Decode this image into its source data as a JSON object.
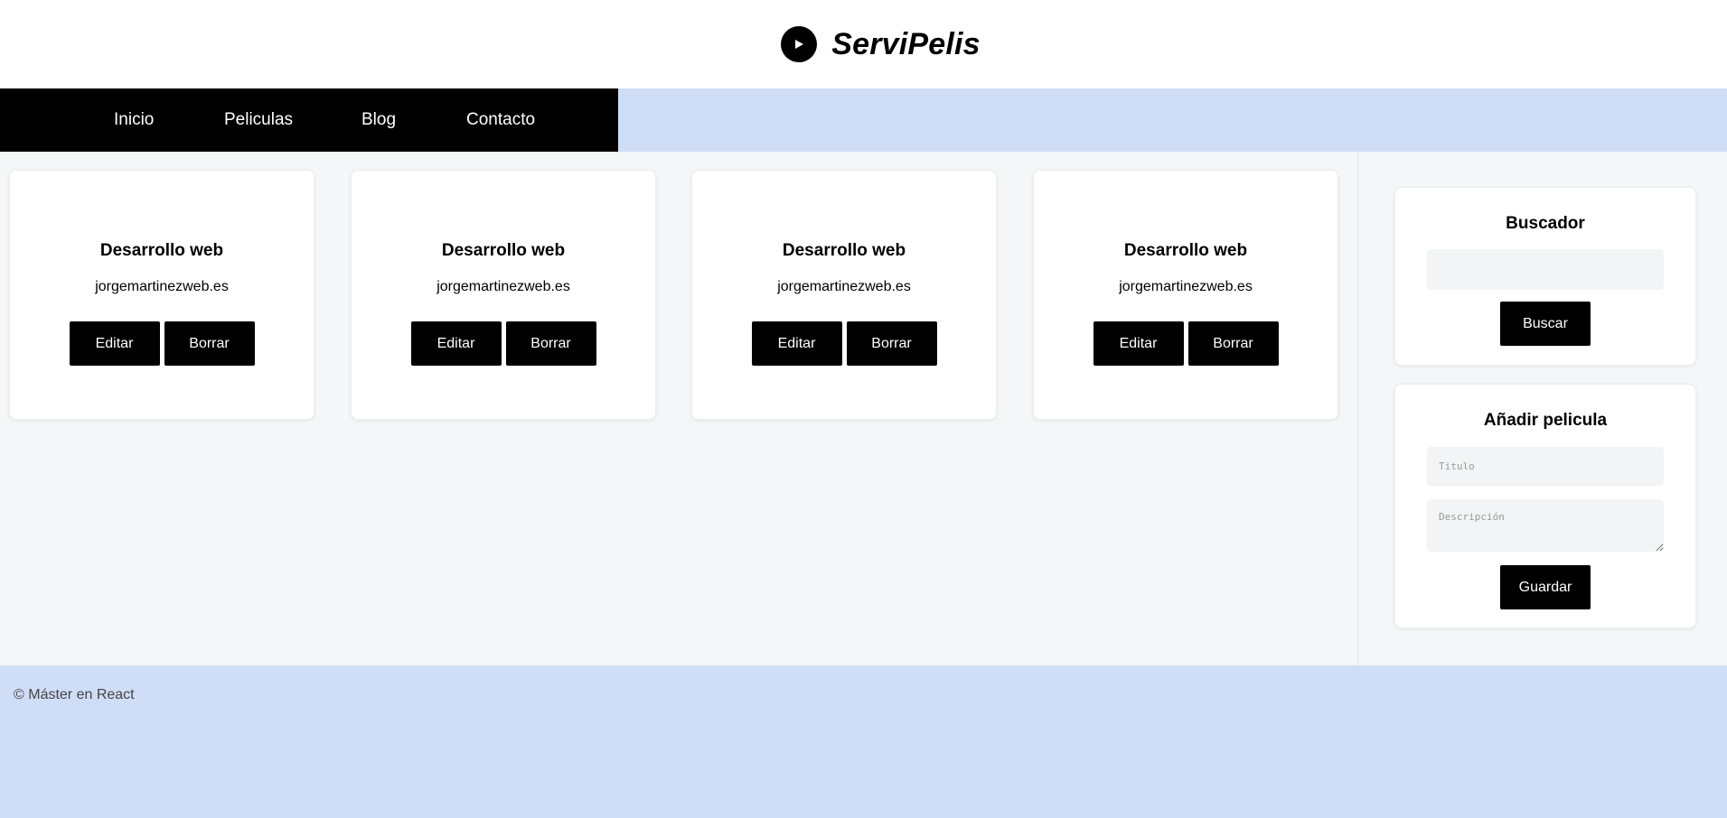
{
  "header": {
    "title": "ServiPelis",
    "logo_icon": "play-icon"
  },
  "nav": {
    "items": [
      {
        "label": "Inicio"
      },
      {
        "label": "Peliculas"
      },
      {
        "label": "Blog"
      },
      {
        "label": "Contacto"
      }
    ]
  },
  "cards": [
    {
      "title": "Desarrollo web",
      "text": "jorgemartinezweb.es",
      "edit_label": "Editar",
      "delete_label": "Borrar"
    },
    {
      "title": "Desarrollo web",
      "text": "jorgemartinezweb.es",
      "edit_label": "Editar",
      "delete_label": "Borrar"
    },
    {
      "title": "Desarrollo web",
      "text": "jorgemartinezweb.es",
      "edit_label": "Editar",
      "delete_label": "Borrar"
    },
    {
      "title": "Desarrollo web",
      "text": "jorgemartinezweb.es",
      "edit_label": "Editar",
      "delete_label": "Borrar"
    }
  ],
  "sidebar": {
    "search": {
      "title": "Buscador",
      "input_value": "",
      "button_label": "Buscar"
    },
    "add_movie": {
      "title": "Añadir pelicula",
      "title_placeholder": "Titulo",
      "description_placeholder": "Descripción",
      "button_label": "Guardar"
    }
  },
  "footer": {
    "text": "© Máster en React"
  },
  "colors": {
    "accent_light": "#d0ddf7",
    "dark": "#000000",
    "background": "#f5f6f8"
  }
}
